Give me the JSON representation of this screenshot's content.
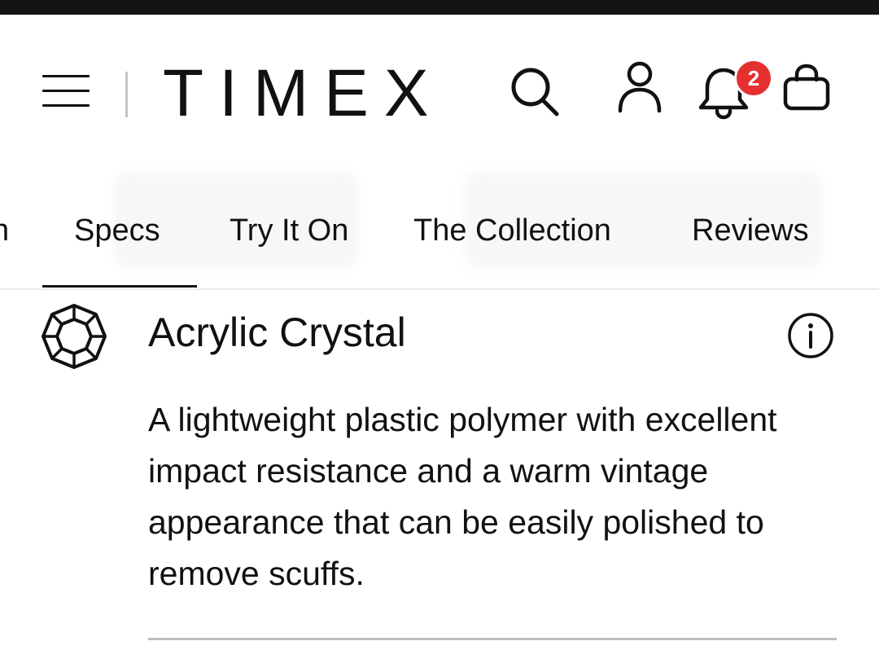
{
  "header": {
    "brand": "TIMEX",
    "notification_count": "2",
    "icons": [
      "menu-icon",
      "search-icon",
      "account-icon",
      "bell-icon",
      "bag-icon"
    ]
  },
  "tabs": [
    {
      "label": "Design",
      "visible_fragment": "n"
    },
    {
      "label": "Specs",
      "active": true
    },
    {
      "label": "Try It On"
    },
    {
      "label": "The Collection"
    },
    {
      "label": "Reviews"
    }
  ],
  "spec": {
    "icon": "crystal-gem-icon",
    "title": "Acrylic Crystal",
    "description": "A lightweight plastic polymer with excellent impact resistance and a warm vintage appearance that can be easily polished to remove scuffs."
  },
  "colors": {
    "text": "#111111",
    "badge": "#e5302f",
    "status_bar": "#141414",
    "divider": "#bdbdbd"
  }
}
